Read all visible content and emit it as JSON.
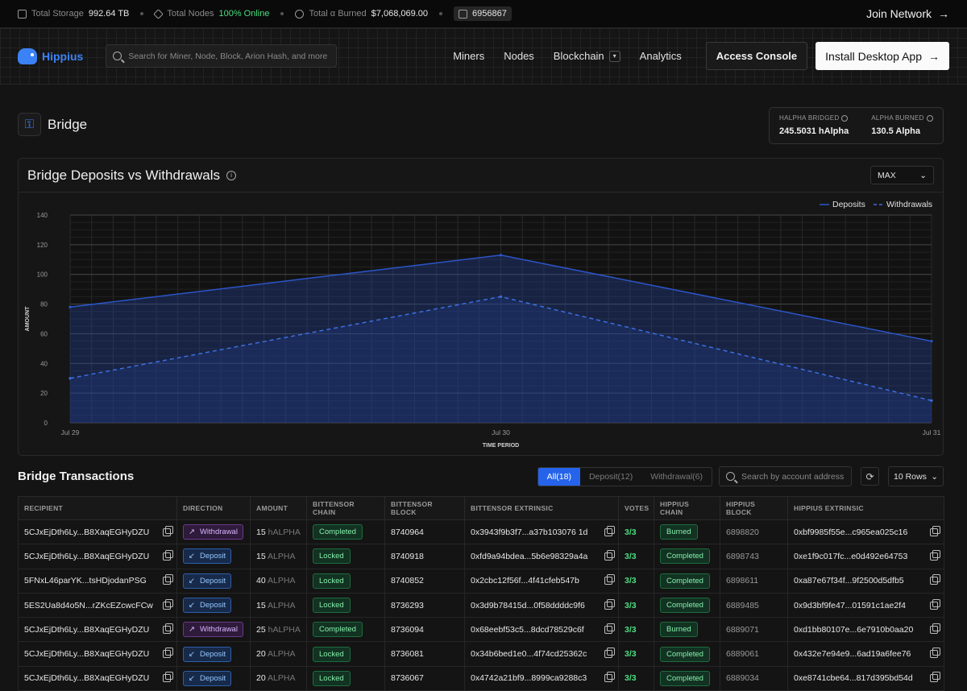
{
  "topbar": {
    "storage_label": "Total Storage",
    "storage_value": "992.64 TB",
    "nodes_label": "Total Nodes",
    "nodes_value": "100% Online",
    "burned_label": "Total α Burned",
    "burned_value": "$7,068,069.00",
    "block_value": "6956867",
    "join_label": "Join Network"
  },
  "nav": {
    "brand": "Hippius",
    "search_placeholder": "Search for Miner, Node, Block, Arion Hash, and more",
    "links": [
      "Miners",
      "Nodes",
      "Blockchain",
      "Analytics"
    ],
    "console_label": "Access Console",
    "install_label": "Install Desktop App"
  },
  "page": {
    "title": "Bridge",
    "stats": [
      {
        "label": "HALPHA BRIDGED",
        "value": "245.5031 hAlpha"
      },
      {
        "label": "ALPHA BURNED",
        "value": "130.5 Alpha"
      }
    ]
  },
  "chart_card": {
    "title": "Bridge Deposits vs Withdrawals",
    "range": "MAX"
  },
  "chart_data": {
    "type": "area",
    "x": [
      "Jul 29",
      "Jul 30",
      "Jul 31"
    ],
    "series": [
      {
        "name": "Deposits",
        "values": [
          78,
          113,
          55
        ],
        "style": "solid"
      },
      {
        "name": "Withdrawals",
        "values": [
          30,
          85,
          15
        ],
        "style": "dashed"
      }
    ],
    "xlabel": "TIME PERIOD",
    "ylabel": "AMOUNT",
    "ylim": [
      0,
      140
    ],
    "yticks": [
      0,
      20,
      40,
      60,
      80,
      100,
      120,
      140
    ],
    "grid": true,
    "legend": "top-right",
    "colors": {
      "deposits": "#2b55c9",
      "withdrawals": "#3b6fe0"
    }
  },
  "transactions": {
    "title": "Bridge Transactions",
    "filters": [
      "All(18)",
      "Deposit(12)",
      "Withdrawal(6)"
    ],
    "search_placeholder": "Search by account address",
    "rows_label": "10 Rows",
    "columns": [
      "RECIPIENT",
      "DIRECTION",
      "AMOUNT",
      "BITTENSOR CHAIN",
      "BITTENSOR BLOCK",
      "BITTENSOR EXTRINSIC",
      "VOTES",
      "HIPPIUS CHAIN",
      "HIPPIUS BLOCK",
      "HIPPIUS EXTRINSIC"
    ],
    "rows": [
      {
        "recipient": "5CJxEjDth6Ly...B8XaqEGHyDZU",
        "direction": "Withdrawal",
        "amount": "15",
        "unit": "hALPHA",
        "bchain": "Completed",
        "bblock": "8740964",
        "bext": "0x3943f9b3f7...a37b103076 1d",
        "votes": "3/3",
        "hchain": "Burned",
        "hblock": "6898820",
        "hext": "0xbf9985f55e...c965ea025c16"
      },
      {
        "recipient": "5CJxEjDth6Ly...B8XaqEGHyDZU",
        "direction": "Deposit",
        "amount": "15",
        "unit": "ALPHA",
        "bchain": "Locked",
        "bblock": "8740918",
        "bext": "0xfd9a94bdea...5b6e98329a4a",
        "votes": "3/3",
        "hchain": "Completed",
        "hblock": "6898743",
        "hext": "0xe1f9c017fc...e0d492e64753"
      },
      {
        "recipient": "5FNxL46parYK...tsHDjodanPSG",
        "direction": "Deposit",
        "amount": "40",
        "unit": "ALPHA",
        "bchain": "Locked",
        "bblock": "8740852",
        "bext": "0x2cbc12f56f...4f41cfeb547b",
        "votes": "3/3",
        "hchain": "Completed",
        "hblock": "6898611",
        "hext": "0xa87e67f34f...9f2500d5dfb5"
      },
      {
        "recipient": "5ES2Ua8d4o5N...rZKcEZcwcFCw",
        "direction": "Deposit",
        "amount": "15",
        "unit": "ALPHA",
        "bchain": "Locked",
        "bblock": "8736293",
        "bext": "0x3d9b78415d...0f58ddddc9f6",
        "votes": "3/3",
        "hchain": "Completed",
        "hblock": "6889485",
        "hext": "0x9d3bf9fe47...01591c1ae2f4"
      },
      {
        "recipient": "5CJxEjDth6Ly...B8XaqEGHyDZU",
        "direction": "Withdrawal",
        "amount": "25",
        "unit": "hALPHA",
        "bchain": "Completed",
        "bblock": "8736094",
        "bext": "0x68eebf53c5...8dcd78529c6f",
        "votes": "3/3",
        "hchain": "Burned",
        "hblock": "6889071",
        "hext": "0xd1bb80107e...6e7910b0aa20"
      },
      {
        "recipient": "5CJxEjDth6Ly...B8XaqEGHyDZU",
        "direction": "Deposit",
        "amount": "20",
        "unit": "ALPHA",
        "bchain": "Locked",
        "bblock": "8736081",
        "bext": "0x34b6bed1e0...4f74cd25362c",
        "votes": "3/3",
        "hchain": "Completed",
        "hblock": "6889061",
        "hext": "0x432e7e94e9...6ad19a6fee76"
      },
      {
        "recipient": "5CJxEjDth6Ly...B8XaqEGHyDZU",
        "direction": "Deposit",
        "amount": "20",
        "unit": "ALPHA",
        "bchain": "Locked",
        "bblock": "8736067",
        "bext": "0x4742a21bf9...8999ca9288c3",
        "votes": "3/3",
        "hchain": "Completed",
        "hblock": "6889034",
        "hext": "0xe8741cbe64...817d395bd54d"
      }
    ]
  }
}
